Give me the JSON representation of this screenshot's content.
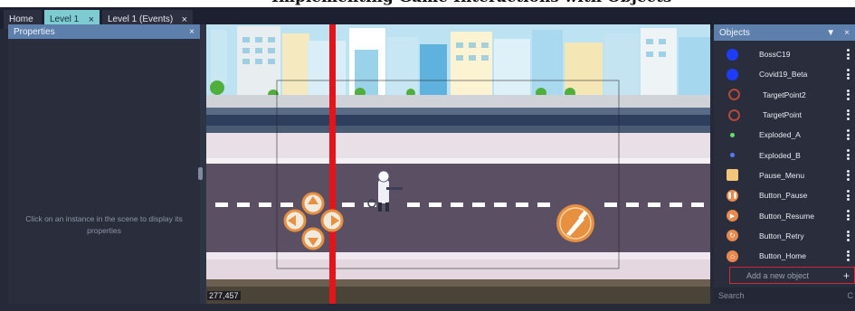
{
  "tabs": [
    {
      "label": "Home"
    },
    {
      "label": "Level 1",
      "close": "×"
    },
    {
      "label": "Level 1 (Events)",
      "close": "×"
    }
  ],
  "properties": {
    "title": "Properties",
    "close": "×",
    "hint": "Click on an instance in the scene to display its properties"
  },
  "scene": {
    "coords": "277,457"
  },
  "objects": {
    "title": "Objects",
    "items": [
      {
        "name": "BossC19",
        "icon": "blue-virus-icon",
        "color": "#1e3cff"
      },
      {
        "name": "Covid19_Beta",
        "icon": "blue-virus-icon",
        "color": "#1e3cff"
      },
      {
        "name": "TargetPoint2",
        "icon": "target-icon",
        "color": "#b24a3a"
      },
      {
        "name": "TargetPoint",
        "icon": "target-icon",
        "color": "#b24a3a"
      },
      {
        "name": "Exploded_A",
        "icon": "green-dot-icon",
        "color": "#5fe06a"
      },
      {
        "name": "Exploded_B",
        "icon": "blue-dot-icon",
        "color": "#5a78ff"
      },
      {
        "name": "Pause_Menu",
        "icon": "menu-panel-icon",
        "color": "#f2c77a"
      },
      {
        "name": "Button_Pause",
        "icon": "pause-icon",
        "color": "#e8894d"
      },
      {
        "name": "Button_Resume",
        "icon": "play-icon",
        "color": "#e8894d"
      },
      {
        "name": "Button_Retry",
        "icon": "retry-icon",
        "color": "#e8894d"
      },
      {
        "name": "Button_Home",
        "icon": "home-icon",
        "color": "#e8894d"
      }
    ],
    "add_label": "Add a new object",
    "add_icon": "+",
    "search_placeholder": "Search"
  }
}
